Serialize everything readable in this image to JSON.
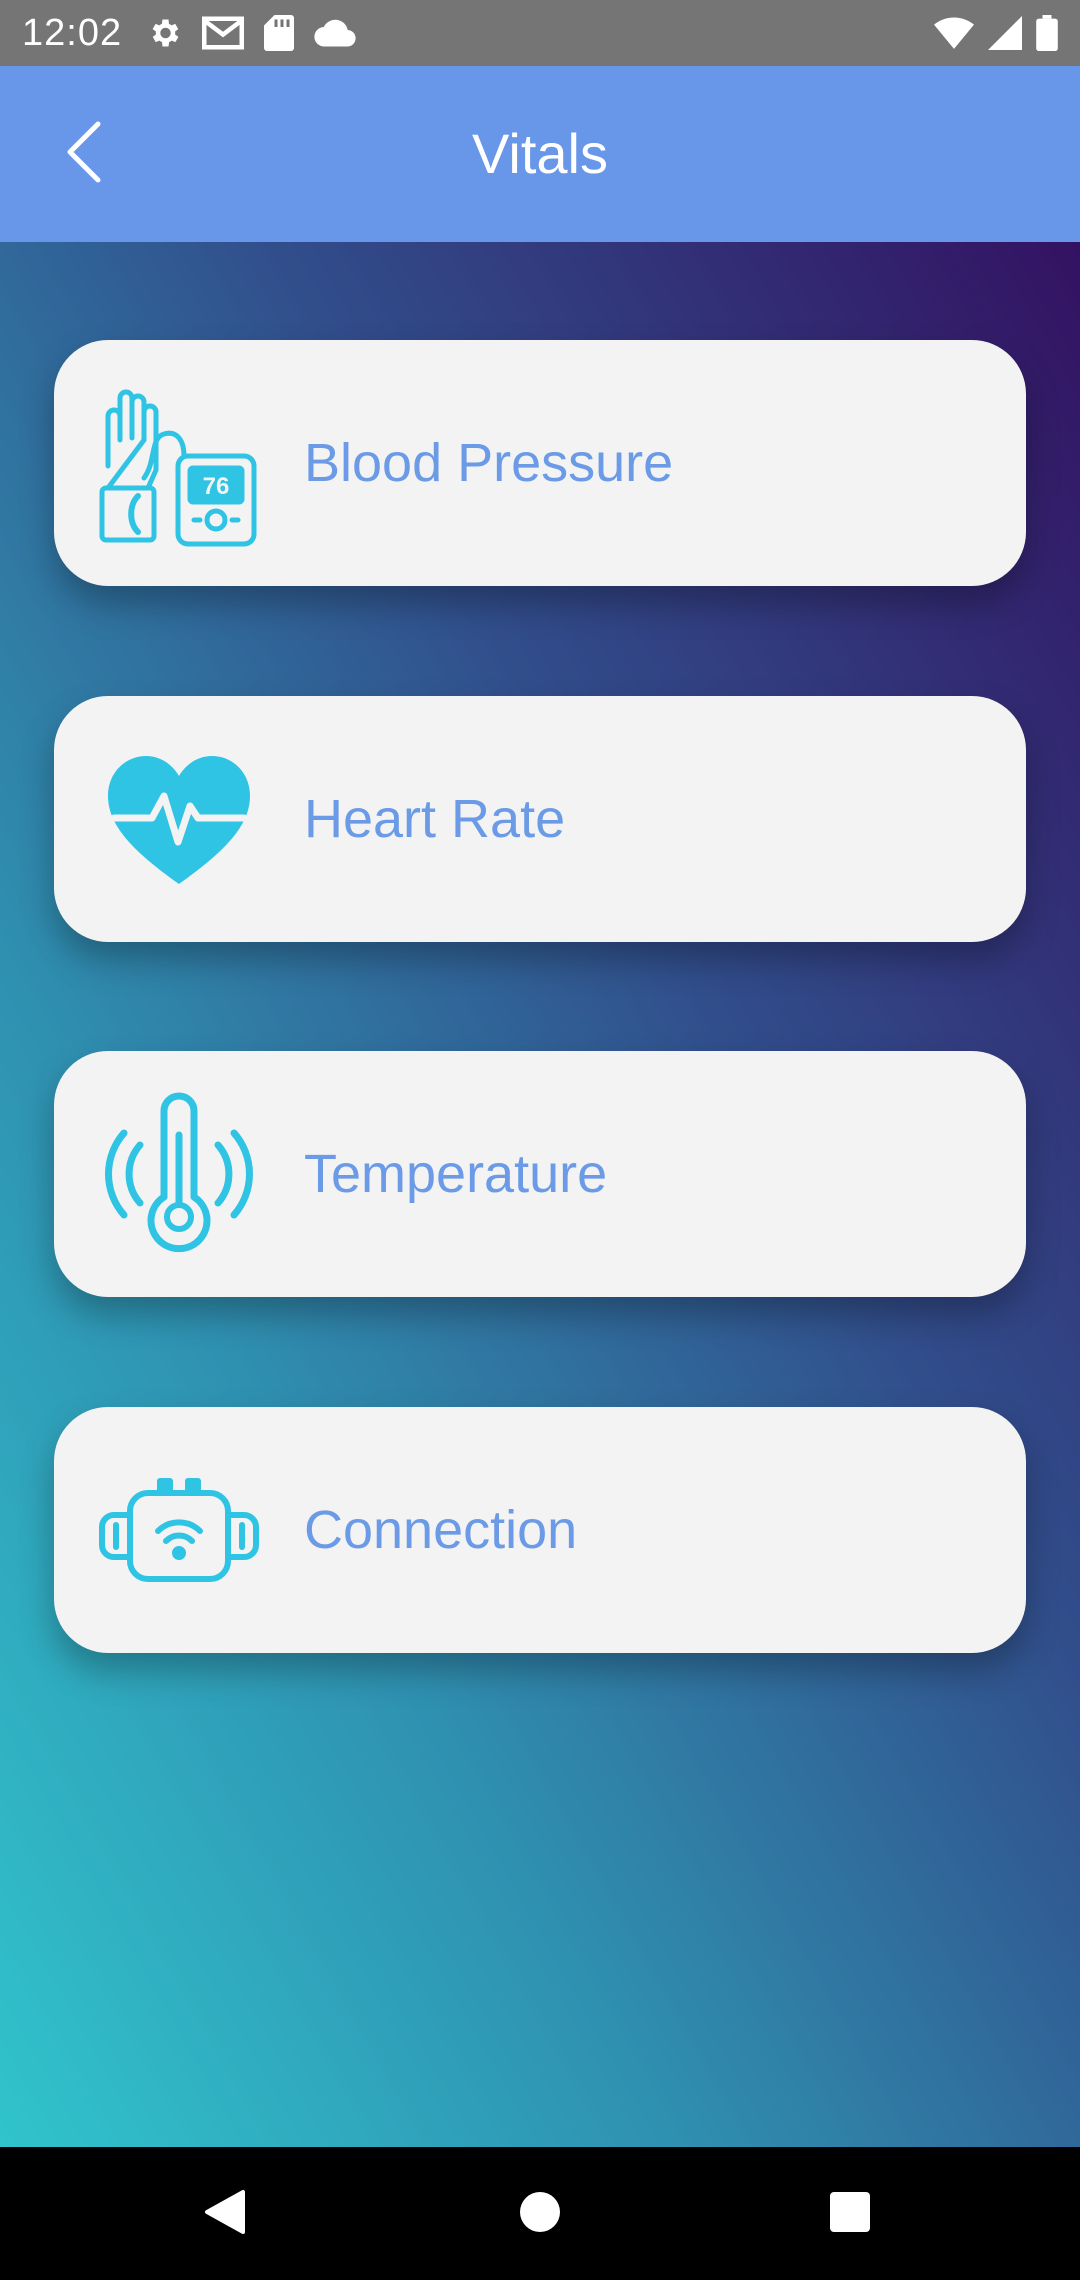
{
  "status_bar": {
    "time": "12:02",
    "left_icons": [
      "settings-icon",
      "gmail-icon",
      "sd-card-icon",
      "cloud-icon"
    ],
    "right_icons": [
      "wifi-icon",
      "cell-signal-icon",
      "battery-icon"
    ]
  },
  "app_bar": {
    "title": "Vitals",
    "back_icon": "chevron-left-icon",
    "color": "#6897ea"
  },
  "vitals": [
    {
      "label": "Blood Pressure",
      "icon": "blood-pressure-icon"
    },
    {
      "label": "Heart Rate",
      "icon": "heart-rate-icon"
    },
    {
      "label": "Temperature",
      "icon": "thermometer-icon"
    },
    {
      "label": "Connection",
      "icon": "wearable-connection-icon"
    }
  ],
  "colors": {
    "card_background": "#f3f3f3",
    "label_color": "#6b9ae6",
    "icon_color": "#2fc3e4",
    "gradient_top": "#331262",
    "gradient_bottom": "#30c4cc"
  },
  "nav_bar": {
    "buttons": [
      "back-triangle-icon",
      "home-circle-icon",
      "recents-square-icon"
    ]
  }
}
